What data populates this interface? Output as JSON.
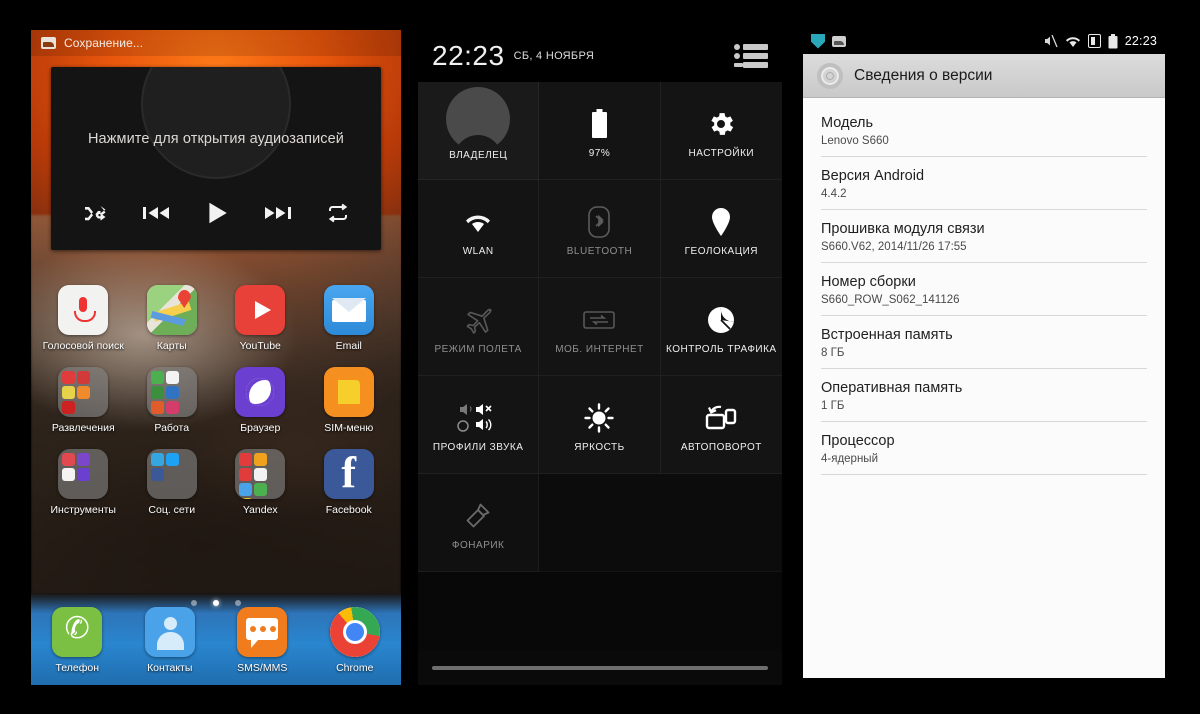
{
  "panel_home": {
    "status": {
      "icon": "gallery-save-icon",
      "text": "Сохранение..."
    },
    "widget": {
      "text": "Нажмите для открытия аудиозаписей",
      "controls": [
        {
          "name": "shuffle-button",
          "glyph": "shuffle-icon"
        },
        {
          "name": "previous-button",
          "glyph": "skip-previous-icon"
        },
        {
          "name": "play-button",
          "glyph": "play-icon"
        },
        {
          "name": "next-button",
          "glyph": "skip-next-icon"
        },
        {
          "name": "repeat-button",
          "glyph": "repeat-icon"
        }
      ]
    },
    "rows": [
      [
        {
          "label": "Голосовой поиск",
          "icon": "voice-search-icon"
        },
        {
          "label": "Карты",
          "icon": "maps-icon"
        },
        {
          "label": "YouTube",
          "icon": "youtube-icon"
        },
        {
          "label": "Email",
          "icon": "email-icon"
        }
      ],
      [
        {
          "label": "Развлечения",
          "icon": "folder-icon"
        },
        {
          "label": "Работа",
          "icon": "folder-icon"
        },
        {
          "label": "Браузер",
          "icon": "browser-icon"
        },
        {
          "label": "SIM-меню",
          "icon": "sim-menu-icon"
        }
      ],
      [
        {
          "label": "Инструменты",
          "icon": "folder-icon"
        },
        {
          "label": "Соц. сети",
          "icon": "folder-icon"
        },
        {
          "label": "Yandex",
          "icon": "folder-icon"
        },
        {
          "label": "Facebook",
          "icon": "facebook-icon"
        }
      ]
    ],
    "dock": [
      {
        "label": "Телефон",
        "icon": "phone-icon"
      },
      {
        "label": "Контакты",
        "icon": "contacts-icon"
      },
      {
        "label": "SMS/MMS",
        "icon": "sms-icon"
      },
      {
        "label": "Chrome",
        "icon": "chrome-icon"
      }
    ],
    "page_indicator": {
      "pages": 3,
      "active": 1
    }
  },
  "panel_quicksettings": {
    "time": "22:23",
    "date": "СБ, 4 НОЯБРЯ",
    "list_toggle": "notification-list-icon",
    "tiles": [
      {
        "label": "ВЛАДЕЛЕЦ",
        "icon": "user-avatar-icon",
        "state": "on",
        "kind": "owner"
      },
      {
        "label": "97%",
        "icon": "battery-icon",
        "state": "on",
        "kind": "tile"
      },
      {
        "label": "НАСТРОЙКИ",
        "icon": "gear-icon",
        "state": "on",
        "kind": "tile"
      },
      {
        "label": "WLAN",
        "icon": "wifi-icon",
        "state": "on",
        "kind": "tile"
      },
      {
        "label": "BLUETOOTH",
        "icon": "bluetooth-icon",
        "state": "off",
        "kind": "tile"
      },
      {
        "label": "ГЕОЛОКАЦИЯ",
        "icon": "location-pin-icon",
        "state": "on",
        "kind": "tile"
      },
      {
        "label": "РЕЖИМ ПОЛЕТА",
        "icon": "airplane-icon",
        "state": "off",
        "kind": "tile"
      },
      {
        "label": "МОБ. ИНТЕРНЕТ",
        "icon": "mobile-data-icon",
        "state": "off",
        "kind": "tile"
      },
      {
        "label": "КОНТРОЛЬ ТРАФИКА",
        "icon": "data-usage-icon",
        "state": "on",
        "kind": "tile"
      },
      {
        "label": "ПРОФИЛИ ЗВУКА",
        "icon": "sound-profiles-icon",
        "state": "on",
        "kind": "tile"
      },
      {
        "label": "ЯРКОСТЬ",
        "icon": "brightness-icon",
        "state": "on",
        "kind": "tile"
      },
      {
        "label": "АВТОПОВОРОТ",
        "icon": "auto-rotate-icon",
        "state": "on",
        "kind": "tile"
      },
      {
        "label": "ФОНАРИК",
        "icon": "flashlight-icon",
        "state": "off",
        "kind": "tile"
      }
    ]
  },
  "panel_about": {
    "status": {
      "left_icons": [
        "shield-icon",
        "gallery-icon"
      ],
      "right_icons": [
        "mute-icon",
        "wifi-icon",
        "sim-card-icon",
        "battery-icon"
      ],
      "clock": "22:23"
    },
    "title": "Сведения о версии",
    "title_icon": "gear-icon",
    "items": [
      {
        "key": "Модель",
        "value": "Lenovo S660"
      },
      {
        "key": "Версия Android",
        "value": "4.4.2"
      },
      {
        "key": "Прошивка модуля связи",
        "value": "S660.V62, 2014/11/26 17:55"
      },
      {
        "key": "Номер сборки",
        "value": "S660_ROW_S062_141126"
      },
      {
        "key": "Встроенная память",
        "value": "8 ГБ"
      },
      {
        "key": "Оперативная память",
        "value": "1 ГБ"
      },
      {
        "key": "Процессор",
        "value": "4-ядерный"
      }
    ]
  },
  "colors": {
    "accent_orange": "#e8560c",
    "panel_dark": "#141414",
    "about_bg": "#fbfbfb",
    "about_header": "#c9c9c9"
  }
}
